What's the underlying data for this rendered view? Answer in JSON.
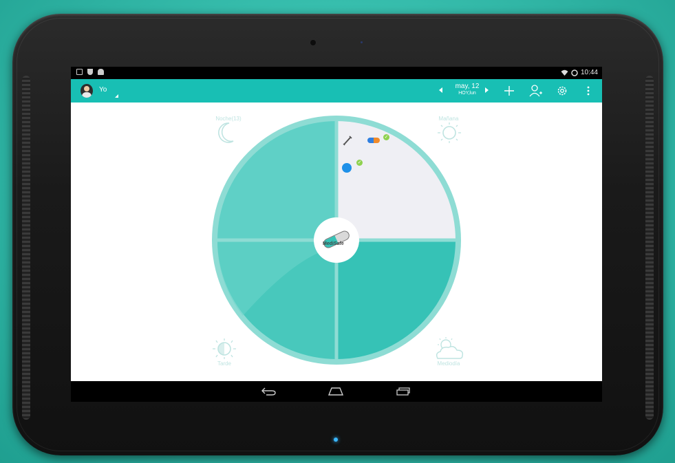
{
  "status_bar": {
    "time": "10:44",
    "left_icons": [
      "image-icon",
      "shield-icon",
      "android-icon"
    ],
    "right_icons": [
      "wifi-icon",
      "battery-icon"
    ]
  },
  "app_bar": {
    "user_name": "Yo",
    "date": "may, 12",
    "date_sub": "HOY,lun",
    "actions": [
      "add-icon",
      "add-person-icon",
      "settings-icon",
      "overflow-menu-icon"
    ]
  },
  "wheel": {
    "center_logo_text": "MediSafe",
    "quadrants": {
      "night": {
        "label": "Noche(13)",
        "icon": "moon-icon"
      },
      "morning": {
        "label": "Mañana",
        "icon": "sun-icon"
      },
      "noon": {
        "label": "Mediodía",
        "icon": "sun-cloud-icon"
      },
      "evening": {
        "label": "Tarde",
        "icon": "sunset-icon"
      }
    },
    "morning_meds": [
      {
        "icon": "syringe-icon",
        "taken": false
      },
      {
        "icon": "capsule-icon",
        "taken": true
      },
      {
        "icon": "round-pill-icon",
        "taken": true
      }
    ]
  },
  "nav_bar": [
    "back-icon",
    "home-icon",
    "recents-icon"
  ],
  "colors": {
    "accent": "#18bfb4",
    "wheel_light": "#5fd0c6",
    "wheel_dark": "#36c2b6",
    "ring": "#8edcd4",
    "active_quadrant": "#efeff4"
  }
}
